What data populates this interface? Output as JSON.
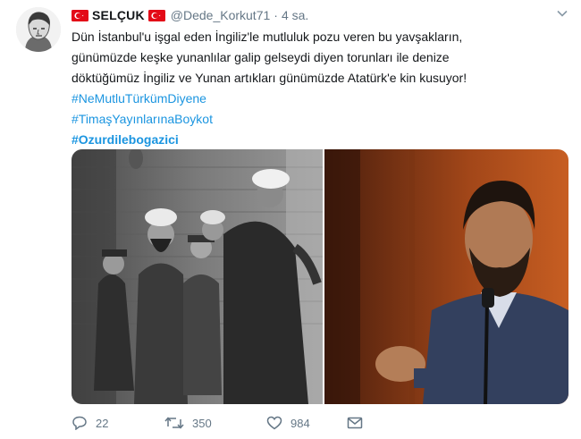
{
  "tweet": {
    "display_name": "SELÇUK",
    "handle": "@Dede_Korkut71",
    "separator": "·",
    "time": "4 sa.",
    "lines": [
      "Dün İstanbul'u işgal eden İngiliz'le mutluluk pozu veren bu yavşakların,",
      "günümüzde keşke  yunanlılar galip gelseydi diyen torunları ile denize",
      "döktüğümüz İngiliz ve Yunan artıkları günümüzde Atatürk'e kin kusuyor!"
    ],
    "hashtags": [
      "#NeMutluTürkümDiyene",
      "#TimaşYayınlarınaBoykot",
      "#Ozurdilebogazici"
    ],
    "actions": {
      "reply_count": "22",
      "retweet_count": "350",
      "like_count": "984"
    }
  },
  "icons": {
    "flag": "turkish-flag-icon",
    "caret": "chevron-down-icon",
    "reply": "reply-icon",
    "retweet": "retweet-icon",
    "like": "heart-icon",
    "message": "direct-message-icon"
  },
  "colors": {
    "hashtag": "#1b95e0",
    "meta": "#657786",
    "text": "#14171a",
    "flag_red": "#e30a17"
  }
}
